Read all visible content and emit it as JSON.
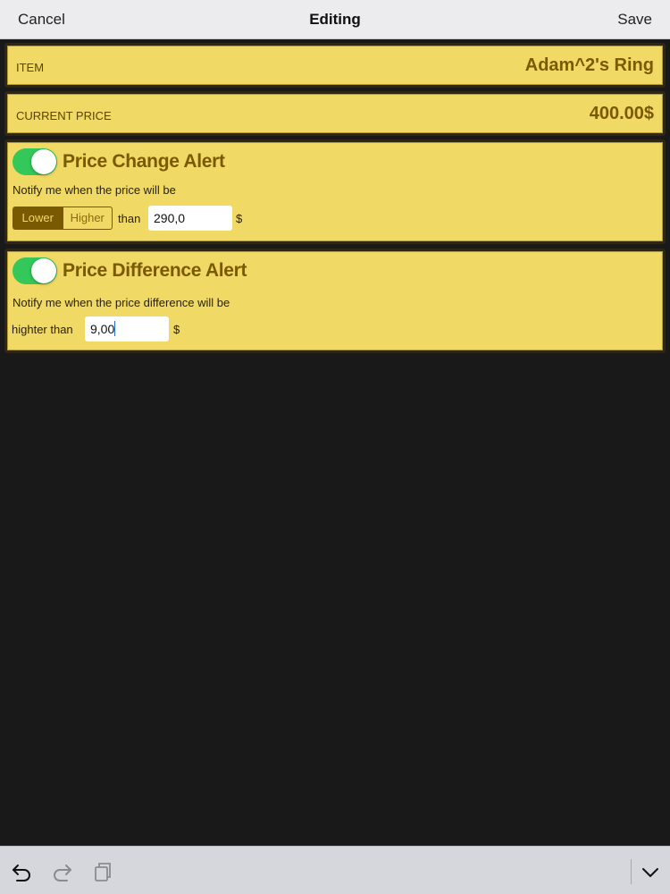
{
  "navbar": {
    "cancel_label": "Cancel",
    "title": "Editing",
    "save_label": "Save"
  },
  "item_row": {
    "label": "ITEM",
    "value": "Adam^2's Ring"
  },
  "price_row": {
    "label": "CURRENT PRICE",
    "value": "400.00$"
  },
  "price_change_alert": {
    "enabled": true,
    "title": "Price Change Alert",
    "description": "Notify me when the price will be",
    "segments": [
      "Lower",
      "Higher"
    ],
    "selected_segment": "Lower",
    "than_label": "than",
    "value": "290,0",
    "currency": "$"
  },
  "price_difference_alert": {
    "enabled": true,
    "title": "Price Difference Alert",
    "description": "Notify me when the price difference will be",
    "prefix_label": "highter than",
    "value": "9,00",
    "currency": "$"
  },
  "toolbar": {
    "icons": [
      "undo-icon",
      "redo-icon",
      "clipboard-icon",
      "keyboard-dismiss-icon"
    ]
  },
  "colors": {
    "card_bg": "#f0d964",
    "accent": "#7a5a00",
    "toggle_on": "#34c759",
    "background": "#1a191a"
  }
}
